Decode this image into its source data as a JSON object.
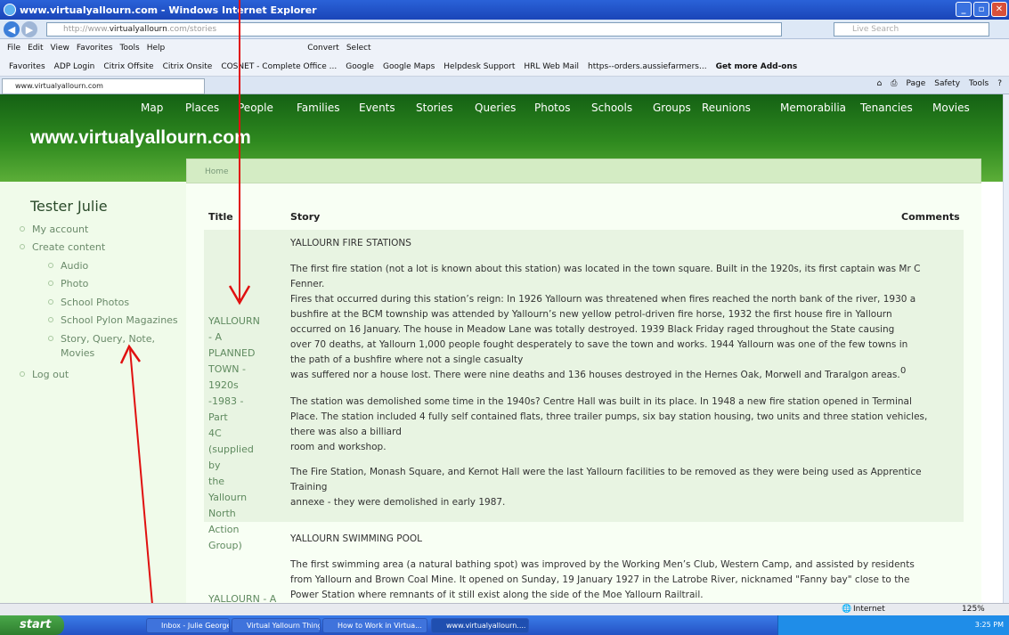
{
  "window": {
    "title": "www.virtualyallourn.com - Windows Internet Explorer"
  },
  "address": {
    "prefix": "http://www.",
    "domain": "virtualyallourn",
    "rest": ".com/stories"
  },
  "search": {
    "placeholder": "Live Search"
  },
  "menubar": [
    "File",
    "Edit",
    "View",
    "Favorites",
    "Tools",
    "Help"
  ],
  "convert": [
    "Convert",
    "Select"
  ],
  "favorites": [
    "Favorites",
    "ADP Login",
    "Citrix Offsite",
    "Citrix Onsite",
    "COSNET - Complete Office ...",
    "Google",
    "Google Maps",
    "Helpdesk Support",
    "HRL Web Mail",
    "https--orders.aussiefarmers...",
    "Get more Add-ons"
  ],
  "tab": {
    "label": "www.virtualyallourn.com"
  },
  "commandbar": [
    "Page",
    "Safety",
    "Tools"
  ],
  "nav": [
    "Map",
    "Places",
    "People",
    "Families",
    "Events",
    "Stories",
    "Queries",
    "Photos",
    "Schools",
    "Groups",
    "Reunions",
    "Memorabilia",
    "Tenancies",
    "Movies"
  ],
  "site_title": "www.virtualyallourn.com",
  "breadcrumb": "Home",
  "sidebar": {
    "user": "Tester Julie",
    "my_account": "My account",
    "create_content": "Create content",
    "audio": "Audio",
    "photo": "Photo",
    "school_photos": "School Photos",
    "school_pylon": "School Pylon Magazines",
    "story_line1": "Story, Query, Note,",
    "story_line2": "Movies",
    "log_out": "Log out"
  },
  "table": {
    "headers": {
      "title": "Title",
      "story": "Story",
      "comments": "Comments"
    },
    "row1": {
      "title_lines": [
        "YALLOURN - A",
        "PLANNED",
        "TOWN - 1920s",
        "-1983 - Part",
        "4C (supplied by",
        "the Yallourn",
        "North Action",
        "Group)"
      ],
      "heading": "YALLOURN FIRE STATIONS",
      "p1": [
        "The first fire station (not a lot is known about this station) was located in the town square. Built in the 1920s, its first captain was Mr C",
        "Fenner.",
        "Fires that occurred during this station’s reign: In 1926 Yallourn was threatened when fires reached the north bank of the river, 1930 a",
        "bushfire at the BCM township was attended by Yallourn’s new yellow petrol-driven fire horse, 1932 the first house fire in Yallourn",
        "occurred on 16 January. The house in Meadow Lane was totally destroyed. 1939 Black Friday raged throughout the State causing",
        "over 70 deaths, at Yallourn 1,000 people fought desperately to save the town and works. 1944 Yallourn was one of the few towns in",
        "the path of a bushfire where not a single casualty",
        "was suffered nor a house lost. There were nine deaths and 136 houses destroyed in the Hernes Oak, Morwell and Traralgon areas."
      ],
      "p2": [
        "The station was demolished some time in the 1940s? Centre Hall was built in its place. In 1948 a new fire station opened in Terminal",
        "Place. The station included 4 fully self contained flats, three trailer pumps, six bay station housing, two units and three station vehicles,",
        "there was also a billiard",
        "room and workshop."
      ],
      "p3": [
        "The Fire Station, Monash Square, and Kernot Hall were the last Yallourn facilities to be removed as they were being used as Apprentice",
        "Training",
        "annexe - they were demolished in early 1987."
      ],
      "comments": "0"
    },
    "row2": {
      "title_partial": "YALLOURN - A",
      "heading": "YALLOURN SWIMMING POOL",
      "p1": [
        "The first swimming area (a natural bathing spot) was improved by the Working Men’s Club, Western Camp, and assisted by residents",
        "from Yallourn and Brown Coal Mine. It opened on Sunday, 19 January 1927 in the Latrobe River, nicknamed \"Fanny bay\" close to the",
        "Power Station where remnants of it still exist along the side of the Moe Yallourn Railtrail."
      ]
    }
  },
  "status": {
    "zone": "Internet",
    "zoom": "125%"
  },
  "taskbar": {
    "start": "start",
    "buttons": [
      "Inbox - Julie George -...",
      "Virtual Yallourn Thing...",
      "How to Work in Virtua...",
      "www.virtualyallourn...."
    ],
    "clock": "3:25 PM"
  },
  "colors": {
    "banner": "#2f8a1f",
    "annotation_arrow": "#e01010"
  }
}
